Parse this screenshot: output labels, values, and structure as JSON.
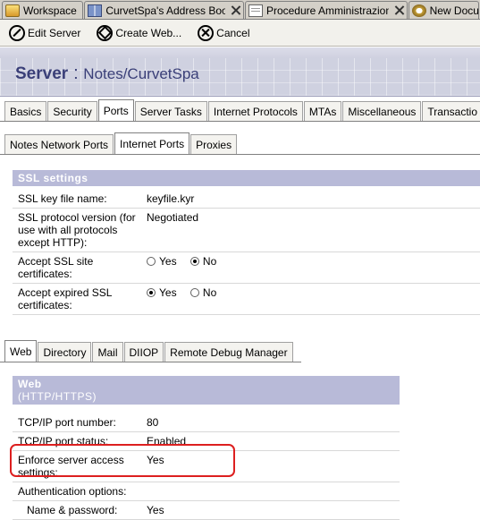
{
  "window_tabs": [
    {
      "label": "Workspace",
      "icon": "workspace-icon"
    },
    {
      "label": "CurvetSpa's Address Book - ...",
      "icon": "address-book-icon"
    },
    {
      "label": "Procedure Amministrazione - ...",
      "icon": "document-icon"
    },
    {
      "label": "New Docu",
      "icon": "gear-icon"
    }
  ],
  "actions": {
    "edit": "Edit Server",
    "create": "Create Web...",
    "cancel": "Cancel"
  },
  "header": {
    "kind": "Server",
    "separator": ":",
    "name": "Notes/CurvetSpa"
  },
  "main_tabs": [
    "Basics",
    "Security",
    "Ports",
    "Server Tasks",
    "Internet Protocols",
    "MTAs",
    "Miscellaneous",
    "Transactio"
  ],
  "main_tabs_active": "Ports",
  "ports_tabs": [
    "Notes Network Ports",
    "Internet Ports",
    "Proxies"
  ],
  "ports_tabs_active": "Internet Ports",
  "ssl": {
    "title": "SSL settings",
    "rows": {
      "key_file": {
        "label": "SSL key file name:",
        "value": "keyfile.kyr"
      },
      "protocol": {
        "label": "SSL protocol version (for use with all protocols except HTTP):",
        "value": "Negotiated"
      },
      "site_certs": {
        "label": "Accept SSL site certificates:",
        "yes": "Yes",
        "no": "No",
        "selected": "No"
      },
      "expired_certs": {
        "label": "Accept expired SSL certificates:",
        "yes": "Yes",
        "no": "No",
        "selected": "Yes"
      }
    }
  },
  "protocol_tabs": [
    "Web",
    "Directory",
    "Mail",
    "DIIOP",
    "Remote Debug Manager"
  ],
  "protocol_tabs_active": "Web",
  "web": {
    "title": "Web",
    "subtitle": "(HTTP/HTTPS)",
    "rows": {
      "port_number": {
        "label": "TCP/IP port number:",
        "value": "80"
      },
      "port_status": {
        "label": "TCP/IP port status:",
        "value": "Enabled"
      },
      "enforce_access": {
        "label": "Enforce server access settings:",
        "value": "Yes"
      },
      "auth_options": {
        "label": "Authentication options:",
        "value": ""
      },
      "name_password": {
        "label": "Name & password:",
        "value": "Yes"
      }
    }
  },
  "colors": {
    "highlight_outline": "#dd1f1f",
    "section_header": "#b8bad8",
    "banner_title": "#3a3f78"
  }
}
